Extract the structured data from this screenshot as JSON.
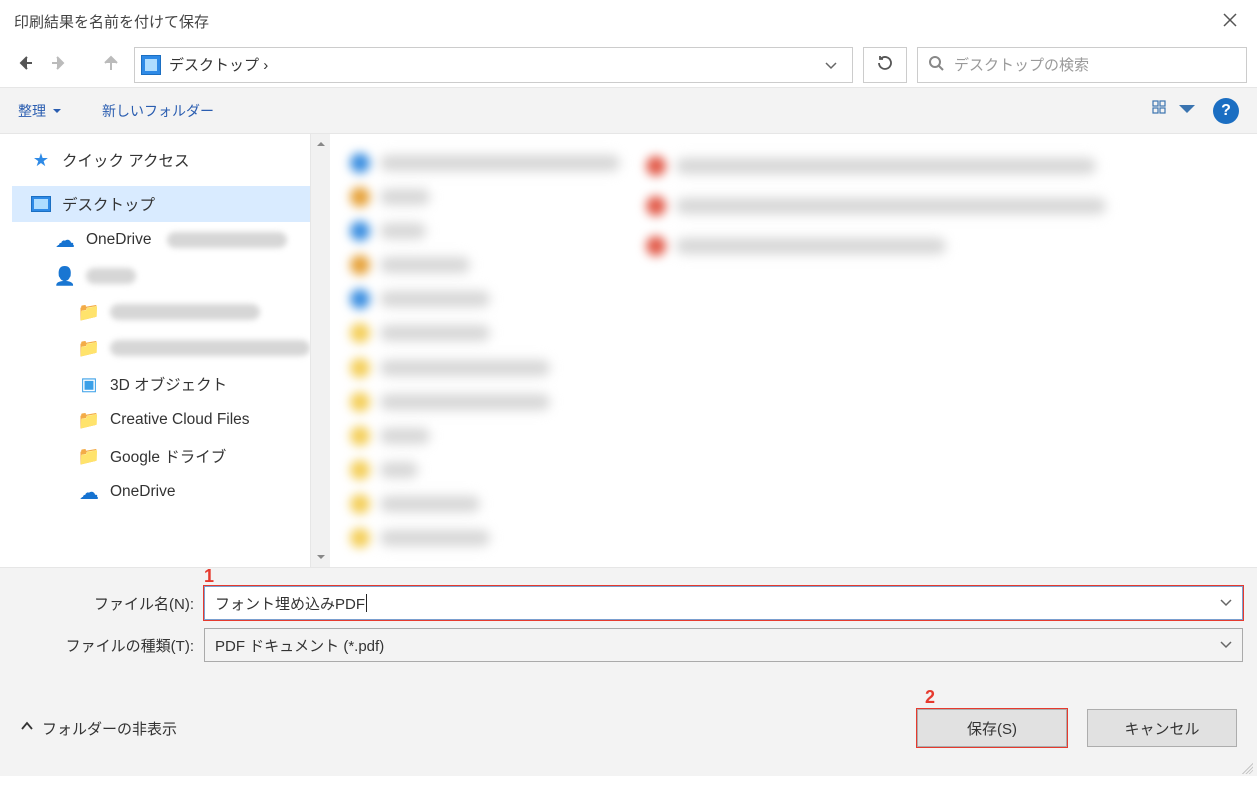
{
  "title": "印刷結果を名前を付けて保存",
  "address": {
    "location": "デスクトップ",
    "separator": "›"
  },
  "search": {
    "placeholder": "デスクトップの検索"
  },
  "toolbar": {
    "organize": "整理",
    "new_folder": "新しいフォルダー",
    "help_symbol": "?"
  },
  "tree": {
    "quick_access": "クイック アクセス",
    "desktop": "デスクトップ",
    "onedrive": "OneDrive",
    "objects3d": "3D オブジェクト",
    "ccfiles": "Creative Cloud Files",
    "gdrive": "Google ドライブ",
    "onedrive2": "OneDrive"
  },
  "fields": {
    "filename_label": "ファイル名(N):",
    "filename_value": "フォント埋め込みPDF",
    "filetype_label": "ファイルの種類(T):",
    "filetype_value": "PDF ドキュメント (*.pdf)"
  },
  "annotations": {
    "one": "1",
    "two": "2"
  },
  "actions": {
    "hide_folders": "フォルダーの非表示",
    "save": "保存(S)",
    "cancel": "キャンセル"
  }
}
